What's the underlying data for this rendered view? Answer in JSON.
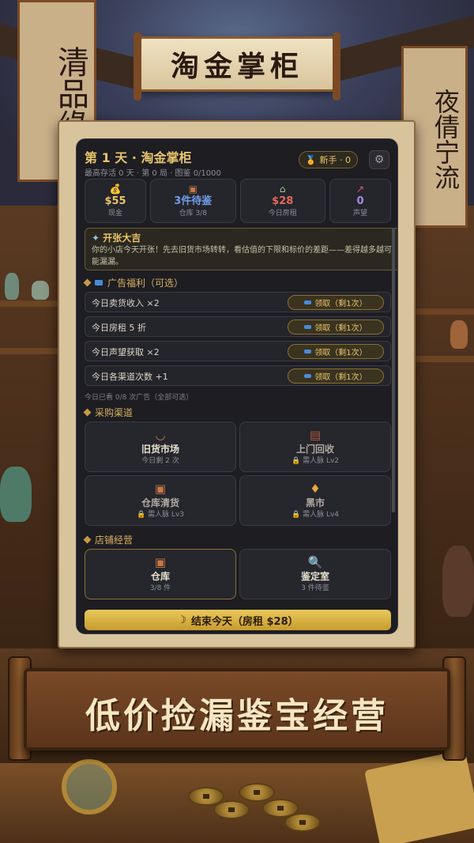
{
  "title": "淘金掌柜",
  "scenery": {
    "left_banner": "清品缘",
    "right_banner": "夜倩宁流"
  },
  "header": {
    "title": "第 1 天 · 淘金掌柜",
    "subtitle": "最高存活 0 天 · 第 0 局 · 图鉴 0/1000",
    "rank_badge": "新手 · 0",
    "rank_icon": "medal-icon",
    "settings_icon": "gear-icon"
  },
  "stats": [
    {
      "icon": "money-bag-icon",
      "value": "$55",
      "label": "现金"
    },
    {
      "icon": "box-icon",
      "value": "3件待鉴",
      "label": "仓库 3/8"
    },
    {
      "icon": "house-icon",
      "value": "$28",
      "label": "今日房租"
    },
    {
      "icon": "chart-icon",
      "value": "0",
      "label": "声望"
    }
  ],
  "event": {
    "title": "开张大吉",
    "body": "你的小店今天开张！先去旧货市场转转，看估值的下限和标价的差距——差得越多越可能漏漏。"
  },
  "ads": {
    "section_title": "广告福利（可选）",
    "items": [
      {
        "label": "今日卖货收入 ×2",
        "button": "领取（剩1次）"
      },
      {
        "label": "今日房租 5 折",
        "button": "领取（剩1次）"
      },
      {
        "label": "今日声望获取 ×2",
        "button": "领取（剩1次）"
      },
      {
        "label": "今日各渠道次数 +1",
        "button": "领取（剩1次）"
      }
    ],
    "note": "今日已看 0/8 次广告（全部可选）"
  },
  "channels": {
    "section_title": "采购渠道",
    "items": [
      {
        "icon": "basket-icon",
        "title": "旧货市场",
        "sub": "今日剩 2 次"
      },
      {
        "icon": "cabinet-icon",
        "title": "上门回收",
        "sub": "需人脉 Lv2"
      },
      {
        "icon": "box-icon",
        "title": "仓库清货",
        "sub": "需人脉 Lv3"
      },
      {
        "icon": "lantern-icon",
        "title": "黑市",
        "sub": "需人脉 Lv4"
      }
    ]
  },
  "shop": {
    "section_title": "店铺经营",
    "items": [
      {
        "icon": "box-icon",
        "title": "仓库",
        "sub": "3/8 件"
      },
      {
        "icon": "magnifier-icon",
        "title": "鉴定室",
        "sub": "3 件待鉴"
      }
    ]
  },
  "end_button": "结束今天（房租 $28）",
  "bottom_banner": "低价捡漏鉴宝经营"
}
